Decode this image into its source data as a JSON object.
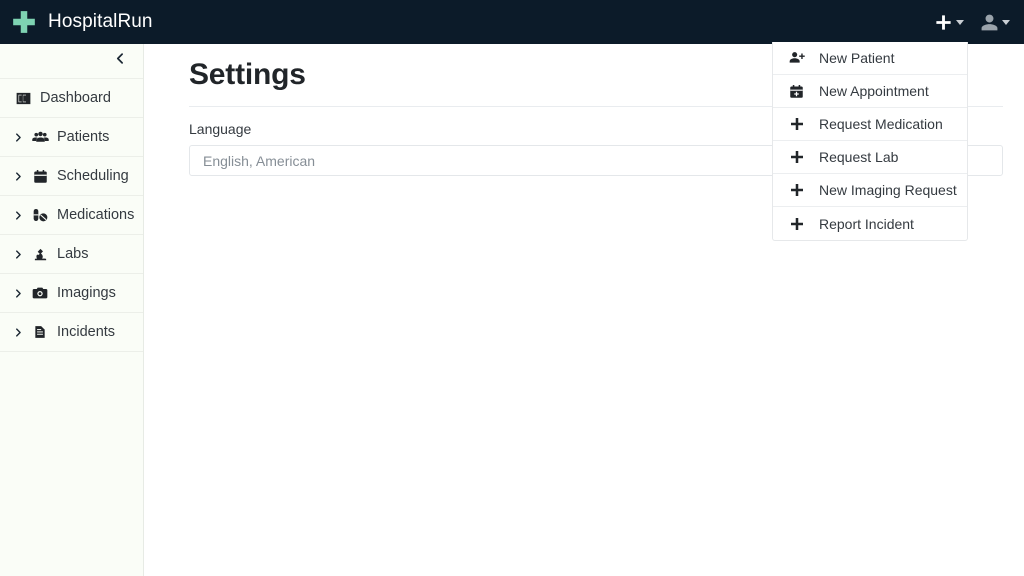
{
  "navbar": {
    "brand": "HospitalRun",
    "logo_icon": "medical-cross-icon",
    "logo_color": "#7ed3b2",
    "background_color": "#0c1b29",
    "add_button_icon": "plus-icon",
    "account_button_icon": "user-icon"
  },
  "sidebar": {
    "background_color": "#fafdf7",
    "collapse_icon": "chevron-left-icon",
    "items": [
      {
        "label": "Dashboard",
        "icon": "dashboard-columns-icon",
        "expandable": false
      },
      {
        "label": "Patients",
        "icon": "users-icon",
        "expandable": true
      },
      {
        "label": "Scheduling",
        "icon": "calendar-icon",
        "expandable": true
      },
      {
        "label": "Medications",
        "icon": "pills-icon",
        "expandable": true
      },
      {
        "label": "Labs",
        "icon": "microscope-icon",
        "expandable": true
      },
      {
        "label": "Imagings",
        "icon": "camera-icon",
        "expandable": true
      },
      {
        "label": "Incidents",
        "icon": "file-document-icon",
        "expandable": true
      }
    ]
  },
  "main": {
    "title": "Settings",
    "language_label": "Language",
    "language_value": "English, American"
  },
  "dropdown_menu": {
    "items": [
      {
        "label": "New Patient",
        "icon": "user-plus-icon"
      },
      {
        "label": "New Appointment",
        "icon": "calendar-plus-icon"
      },
      {
        "label": "Request Medication",
        "icon": "plus-icon"
      },
      {
        "label": "Request Lab",
        "icon": "plus-icon"
      },
      {
        "label": "New Imaging Request",
        "icon": "plus-icon"
      },
      {
        "label": "Report Incident",
        "icon": "plus-icon"
      }
    ]
  }
}
